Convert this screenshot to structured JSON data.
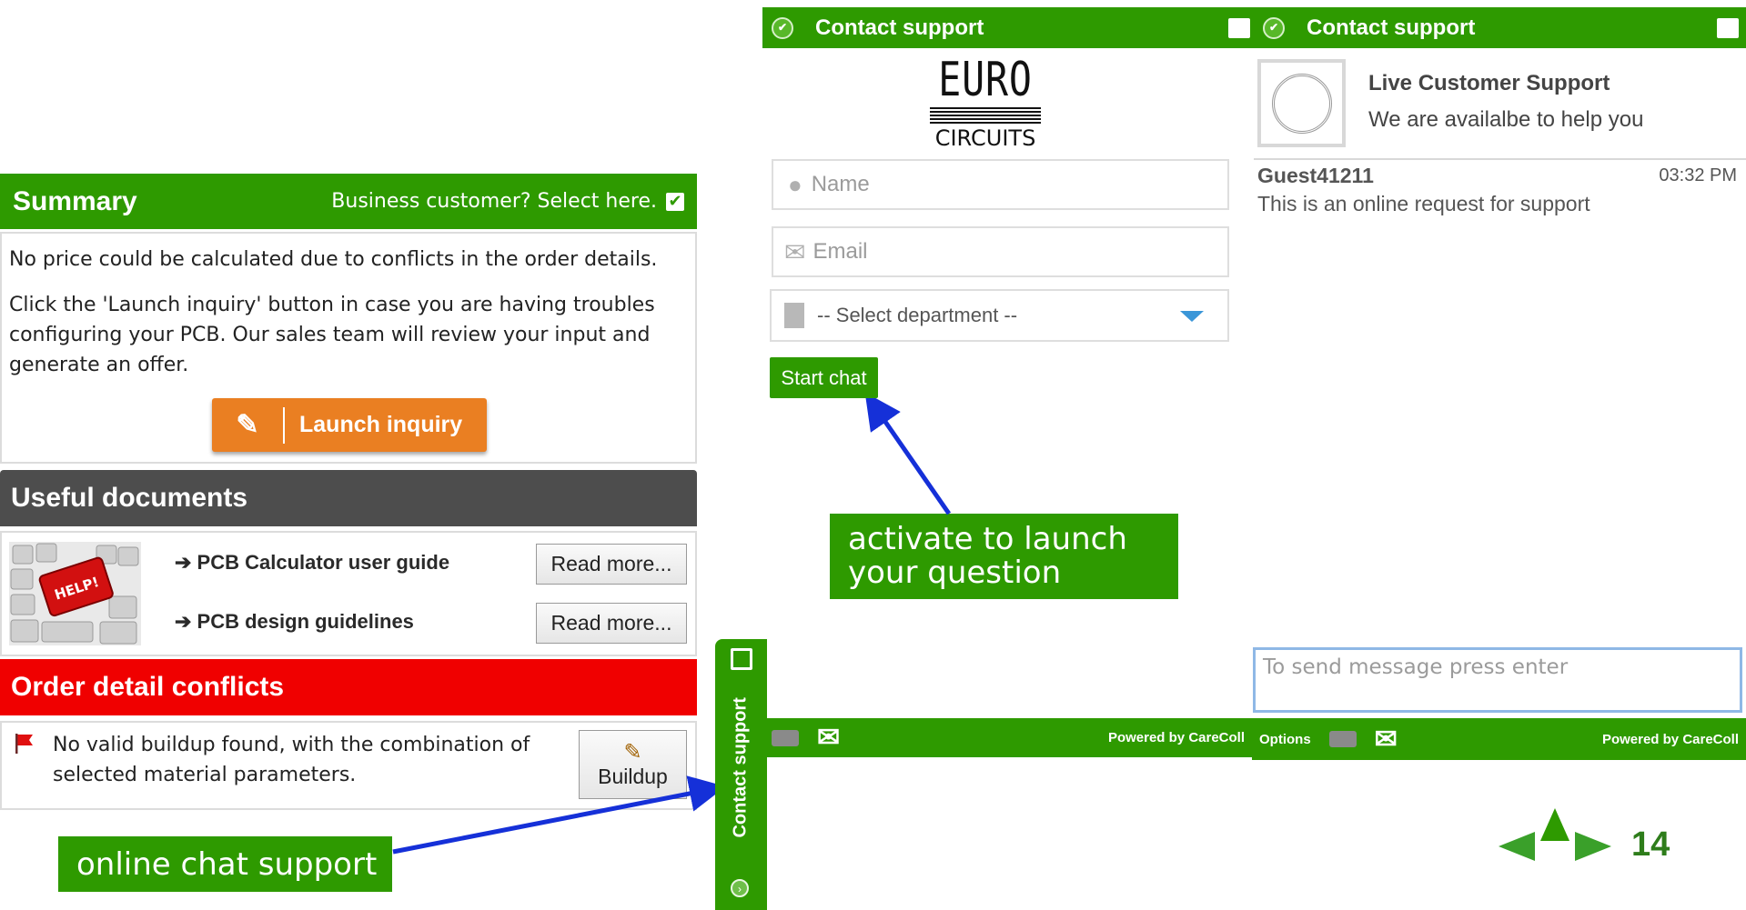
{
  "summary": {
    "title": "Summary",
    "business_label": "Business customer? Select here.",
    "message": "No price could be calculated due to conflicts in the order details.",
    "instructions": "Click the 'Launch inquiry' button in case you are having troubles configuring your PCB. Our sales team will review your input and generate an offer.",
    "launch_label": "Launch inquiry"
  },
  "documents": {
    "title": "Useful documents",
    "items": [
      {
        "label": "➔ PCB Calculator user guide",
        "button": "Read more..."
      },
      {
        "label": "➔ PCB design guidelines",
        "button": "Read more..."
      }
    ]
  },
  "conflicts": {
    "title": "Order detail conflicts",
    "message": "No valid buildup found, with the combination of selected material parameters.",
    "buildup_label": "Buildup"
  },
  "callouts": {
    "chat": "online chat support",
    "activate": "activate to launch your question"
  },
  "side_tab": {
    "label": "Contact support"
  },
  "chat_form": {
    "title": "Contact support",
    "logo_top": "EURO",
    "logo_bottom": "CIRCUITS",
    "name_placeholder": "Name",
    "email_placeholder": "Email",
    "department_placeholder": "-- Select department --",
    "start_label": "Start chat",
    "powered": "Powered by CareColl"
  },
  "chat_window": {
    "title": "Contact support",
    "agent_title": "Live Customer Support",
    "agent_subtitle": "We are availalbe to help you",
    "guest_name": "Guest41211",
    "time": "03:32 PM",
    "guest_message": "This is an online request for support",
    "input_placeholder": "To send message press enter",
    "options_label": "Options",
    "powered": "Powered by CareColl"
  },
  "page_number": "14",
  "colors": {
    "green": "#2e9a00",
    "red": "#f00000",
    "dark": "#4d4d4d",
    "orange": "#ea7f22",
    "arrow_blue": "#1530d8"
  }
}
